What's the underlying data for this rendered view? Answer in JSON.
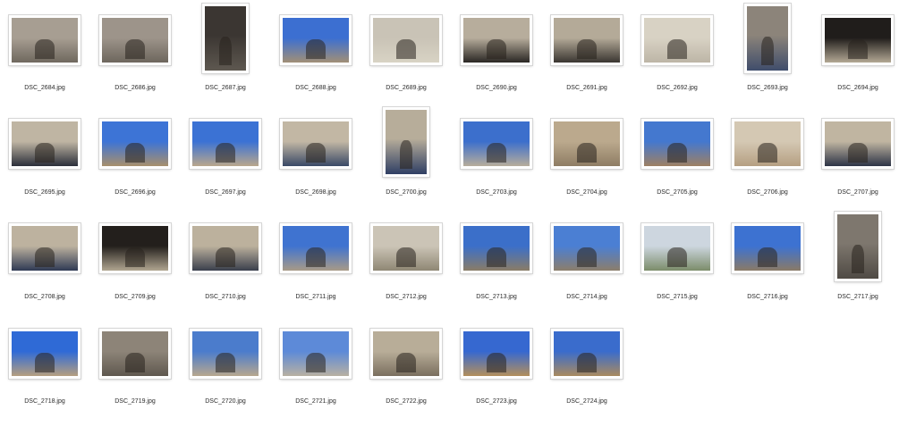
{
  "files": [
    {
      "name": "DSC_2684.jpg",
      "orientation": "landscape",
      "palette": [
        "#a79e92",
        "#6f685e"
      ]
    },
    {
      "name": "DSC_2686.jpg",
      "orientation": "landscape",
      "palette": [
        "#9d948a",
        "#6d665d"
      ]
    },
    {
      "name": "DSC_2687.jpg",
      "orientation": "portrait",
      "palette": [
        "#3b3632",
        "#5e5850"
      ]
    },
    {
      "name": "DSC_2688.jpg",
      "orientation": "landscape",
      "palette": [
        "#3c6fd1",
        "#a18f76"
      ]
    },
    {
      "name": "DSC_2689.jpg",
      "orientation": "landscape",
      "palette": [
        "#c9c3b6",
        "#d8d3c4"
      ]
    },
    {
      "name": "DSC_2690.jpg",
      "orientation": "landscape",
      "palette": [
        "#b7ad9c",
        "#2a2724"
      ]
    },
    {
      "name": "DSC_2691.jpg",
      "orientation": "landscape",
      "palette": [
        "#b4aa98",
        "#3a3631"
      ]
    },
    {
      "name": "DSC_2692.jpg",
      "orientation": "landscape",
      "palette": [
        "#d8d2c4",
        "#bdb5a6"
      ]
    },
    {
      "name": "DSC_2693.jpg",
      "orientation": "portrait",
      "palette": [
        "#8c847a",
        "#3f4d6b"
      ]
    },
    {
      "name": "DSC_2694.jpg",
      "orientation": "landscape",
      "palette": [
        "#201d1b",
        "#b3a894"
      ]
    },
    {
      "name": "DSC_2695.jpg",
      "orientation": "landscape",
      "palette": [
        "#bfb5a3",
        "#2b2f3a"
      ]
    },
    {
      "name": "DSC_2696.jpg",
      "orientation": "landscape",
      "palette": [
        "#3d74d6",
        "#a88f6c"
      ]
    },
    {
      "name": "DSC_2697.jpg",
      "orientation": "landscape",
      "palette": [
        "#3b72d4",
        "#b9a78c"
      ]
    },
    {
      "name": "DSC_2698.jpg",
      "orientation": "landscape",
      "palette": [
        "#c2b7a4",
        "#3a4966"
      ]
    },
    {
      "name": "DSC_2700.jpg",
      "orientation": "portrait",
      "palette": [
        "#b7ad9a",
        "#2f3f64"
      ]
    },
    {
      "name": "DSC_2703.jpg",
      "orientation": "landscape",
      "palette": [
        "#3c6fcc",
        "#b7ad9b"
      ]
    },
    {
      "name": "DSC_2704.jpg",
      "orientation": "landscape",
      "palette": [
        "#bba98d",
        "#8e7d64"
      ]
    },
    {
      "name": "DSC_2705.jpg",
      "orientation": "landscape",
      "palette": [
        "#4478cf",
        "#9e8063"
      ]
    },
    {
      "name": "DSC_2706.jpg",
      "orientation": "landscape",
      "palette": [
        "#d4c8b3",
        "#b59f82"
      ]
    },
    {
      "name": "DSC_2707.jpg",
      "orientation": "landscape",
      "palette": [
        "#c0b5a1",
        "#2d3446"
      ]
    },
    {
      "name": "DSC_2708.jpg",
      "orientation": "landscape",
      "palette": [
        "#bdb29f",
        "#2f3a54"
      ]
    },
    {
      "name": "DSC_2709.jpg",
      "orientation": "landscape",
      "palette": [
        "#231f1c",
        "#b0a590"
      ]
    },
    {
      "name": "DSC_2710.jpg",
      "orientation": "landscape",
      "palette": [
        "#bcb19d",
        "#3a3f4c"
      ]
    },
    {
      "name": "DSC_2711.jpg",
      "orientation": "landscape",
      "palette": [
        "#3f73d0",
        "#a89a87"
      ]
    },
    {
      "name": "DSC_2712.jpg",
      "orientation": "landscape",
      "palette": [
        "#cbc4b6",
        "#8f8774"
      ]
    },
    {
      "name": "DSC_2713.jpg",
      "orientation": "landscape",
      "palette": [
        "#3b6fc9",
        "#8a7c66"
      ]
    },
    {
      "name": "DSC_2714.jpg",
      "orientation": "landscape",
      "palette": [
        "#4b7fd3",
        "#8c7e6b"
      ]
    },
    {
      "name": "DSC_2715.jpg",
      "orientation": "landscape",
      "palette": [
        "#cdd6df",
        "#7b8c6a"
      ]
    },
    {
      "name": "DSC_2716.jpg",
      "orientation": "landscape",
      "palette": [
        "#3d72d1",
        "#8a7a66"
      ]
    },
    {
      "name": "DSC_2717.jpg",
      "orientation": "portrait",
      "palette": [
        "#7e776e",
        "#4f4a44"
      ]
    },
    {
      "name": "DSC_2718.jpg",
      "orientation": "landscape",
      "palette": [
        "#2f6ad6",
        "#b59f80"
      ]
    },
    {
      "name": "DSC_2719.jpg",
      "orientation": "landscape",
      "palette": [
        "#8d8478",
        "#5f584f"
      ]
    },
    {
      "name": "DSC_2720.jpg",
      "orientation": "landscape",
      "palette": [
        "#4b7ccc",
        "#b7a78f"
      ]
    },
    {
      "name": "DSC_2721.jpg",
      "orientation": "landscape",
      "palette": [
        "#5d8ad8",
        "#b8b0a2"
      ]
    },
    {
      "name": "DSC_2722.jpg",
      "orientation": "landscape",
      "palette": [
        "#b8ad98",
        "#7a6f5f"
      ]
    },
    {
      "name": "DSC_2723.jpg",
      "orientation": "landscape",
      "palette": [
        "#3668d0",
        "#b38f5c"
      ]
    },
    {
      "name": "DSC_2724.jpg",
      "orientation": "landscape",
      "palette": [
        "#3a6ccc",
        "#a98a5f"
      ]
    }
  ]
}
